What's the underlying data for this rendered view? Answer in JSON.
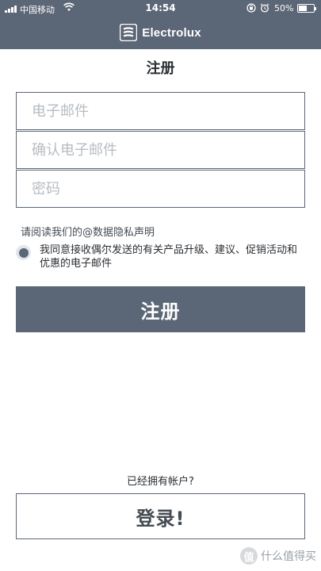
{
  "status_bar": {
    "carrier": "中国移动",
    "time": "14:54",
    "battery_text": "50%",
    "battery_level": 0.5,
    "icons": [
      "signal-icon",
      "wifi-icon",
      "rotation-lock-icon",
      "alarm-icon",
      "battery-icon"
    ]
  },
  "header": {
    "brand": "Electrolux",
    "background": "#5b6676"
  },
  "page": {
    "title": "注册"
  },
  "form": {
    "email_placeholder": "电子邮件",
    "confirm_email_placeholder": "确认电子邮件",
    "password_placeholder": "密码",
    "privacy_text": "请阅读我们的@数据隐私声明",
    "consent_text": "我同意接收偶尔发送的有关产品升级、建议、促销活动和优惠的电子邮件",
    "consent_selected": true,
    "register_label": "注册"
  },
  "footer": {
    "have_account_text": "已经拥有帐户?",
    "login_label": "登录!"
  },
  "watermark": {
    "icon_text": "值",
    "text": "什么值得买"
  },
  "colors": {
    "accent": "#5b6676",
    "text": "#2b2f33",
    "placeholder": "#b7bcc2"
  }
}
